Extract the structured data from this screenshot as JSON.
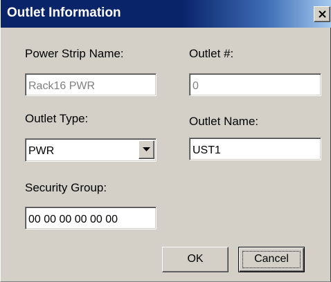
{
  "window": {
    "title": "Outlet Information",
    "close_icon": "close-icon"
  },
  "form": {
    "power_strip_name_label": "Power Strip Name:",
    "power_strip_name_value": "Rack16 PWR",
    "outlet_number_label": "Outlet #:",
    "outlet_number_value": "0",
    "outlet_type_label": "Outlet Type:",
    "outlet_type_value": "PWR",
    "outlet_name_label": "Outlet Name:",
    "outlet_name_value": "UST1",
    "security_group_label": "Security Group:",
    "security_group_value": "00 00 00 00 00 00"
  },
  "buttons": {
    "ok_label": "OK",
    "cancel_label": "Cancel"
  },
  "colors": {
    "titlebar": "#0a246a",
    "face": "#d4d0c8",
    "disabled_text": "#808080"
  }
}
